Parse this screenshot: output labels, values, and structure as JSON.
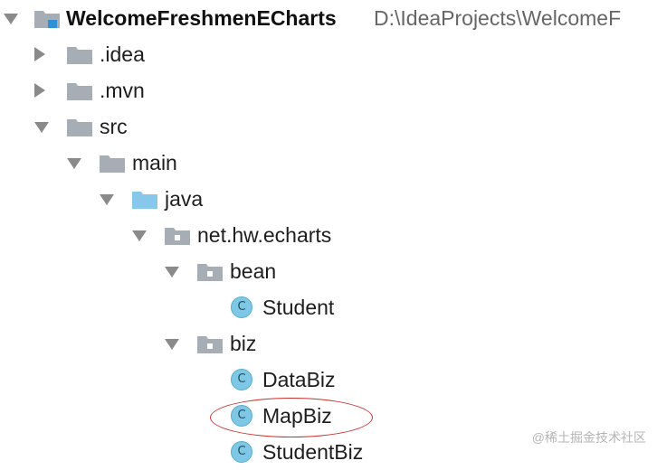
{
  "project": {
    "name": "WelcomeFreshmenECharts",
    "path": "D:\\IdeaProjects\\WelcomeF"
  },
  "tree": {
    "idea": ".idea",
    "mvn": ".mvn",
    "src": "src",
    "main": "main",
    "java": "java",
    "package": "net.hw.echarts",
    "bean": "bean",
    "student": "Student",
    "biz": "biz",
    "data_biz": "DataBiz",
    "map_biz": "MapBiz",
    "student_biz": "StudentBiz"
  },
  "icons": {
    "class_letter": "C",
    "folder_color": "#a7adb4",
    "source_folder_color": "#87c8ea",
    "class_color": "#7ec8e6"
  },
  "annotation": {
    "highlight_color": "#c9302c"
  },
  "watermark": "@稀土掘金技术社区"
}
